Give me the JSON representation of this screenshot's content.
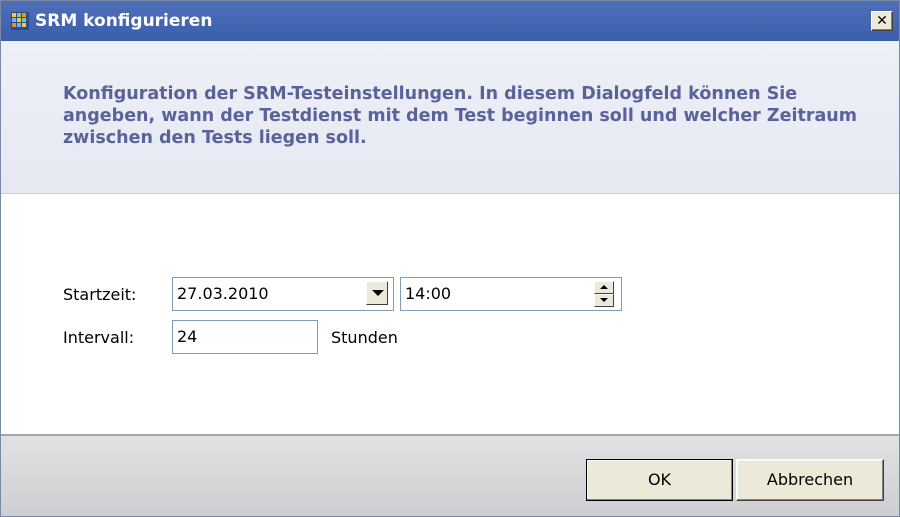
{
  "window": {
    "title": "SRM konfigurieren",
    "app_icon": "app-grid-icon",
    "close_symbol": "✕"
  },
  "header": {
    "description": "Konfiguration der SRM-Testeinstellungen. In diesem Dialogfeld können Sie angeben, wann der Testdienst mit dem Test beginnen soll und welcher Zeitraum zwischen den Tests liegen soll."
  },
  "form": {
    "start_label": "Startzeit:",
    "date_value": "27.03.2010",
    "time_value": "14:00",
    "interval_label": "Intervall:",
    "interval_value": "24",
    "interval_unit": "Stunden"
  },
  "footer": {
    "ok_label": "OK",
    "cancel_label": "Abbrechen"
  },
  "colors": {
    "titlebar": "#3b5fad",
    "description_text": "#5a629a",
    "header_band": "#eef0f8",
    "footer_band": "#d8d8dc"
  }
}
